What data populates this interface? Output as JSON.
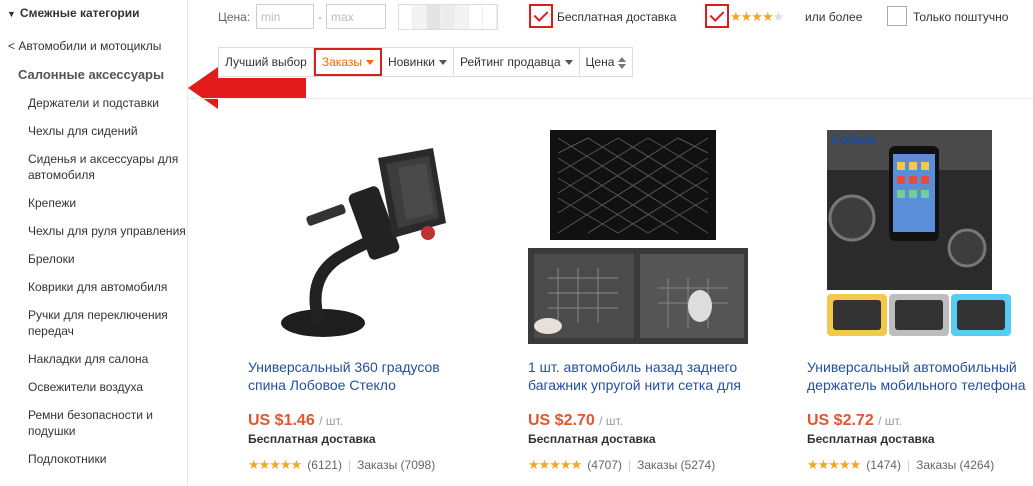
{
  "sidebar": {
    "header": "Смежные категории",
    "back_link": "< Автомобили и мотоциклы",
    "current": "Салонные аксессуары",
    "items": [
      "Держатели и подставки",
      "Чехлы для сидений",
      "Сиденья и аксессуары для автомобиля",
      "Крепежи",
      "Чехлы для руля управления",
      "Брелоки",
      "Коврики для автомобиля",
      "Ручки для переключения передач",
      "Накладки для салона",
      "Освежители воздуха",
      "Ремни безопасности и подушки",
      "Подлокотники"
    ]
  },
  "filters": {
    "price_label": "Цена:",
    "min_placeholder": "min",
    "max_placeholder": "max",
    "dash": "-",
    "free_shipping_label": "Бесплатная доставка",
    "free_shipping_checked": true,
    "rating_checked": true,
    "rating_stars": "★★★★",
    "rating_empty_star": "★",
    "rating_suffix": "или более",
    "single_label": "Только поштучно",
    "single_checked": false
  },
  "sort": {
    "best": "Лучший выбор",
    "orders": "Заказы",
    "newest": "Новинки",
    "seller_rating": "Рейтинг продавца",
    "price": "Цена",
    "active": "orders"
  },
  "products": [
    {
      "title": "Универсальный 360 градусов спина Лобовое Стекло",
      "price": "US $1.46",
      "unit": "/ шт.",
      "shipping": "Бесплатная доставка",
      "stars": "★★★★★",
      "reviews": "(6121)",
      "orders": "Заказы (7098)"
    },
    {
      "title": "1 шт. автомобиль назад заднего багажник упругой нити сетка для",
      "price": "US $2.70",
      "unit": "/ шт.",
      "shipping": "Бесплатная доставка",
      "stars": "★★★★★",
      "reviews": "(4707)",
      "orders": "Заказы (5274)"
    },
    {
      "title": "Универсальный автомобильный держатель мобильного телефона",
      "price": "US $2.72",
      "unit": "/ шт.",
      "shipping": "Бесплатная доставка",
      "stars": "★★★★★",
      "reviews": "(1474)",
      "orders": "Заказы (4264)",
      "image_brand": "Cobao"
    }
  ],
  "colors": {
    "accent_orange": "#f60",
    "price": "#e4552e",
    "highlight_red": "#d7201c",
    "title_link": "#23509e",
    "star": "#f5a623"
  }
}
